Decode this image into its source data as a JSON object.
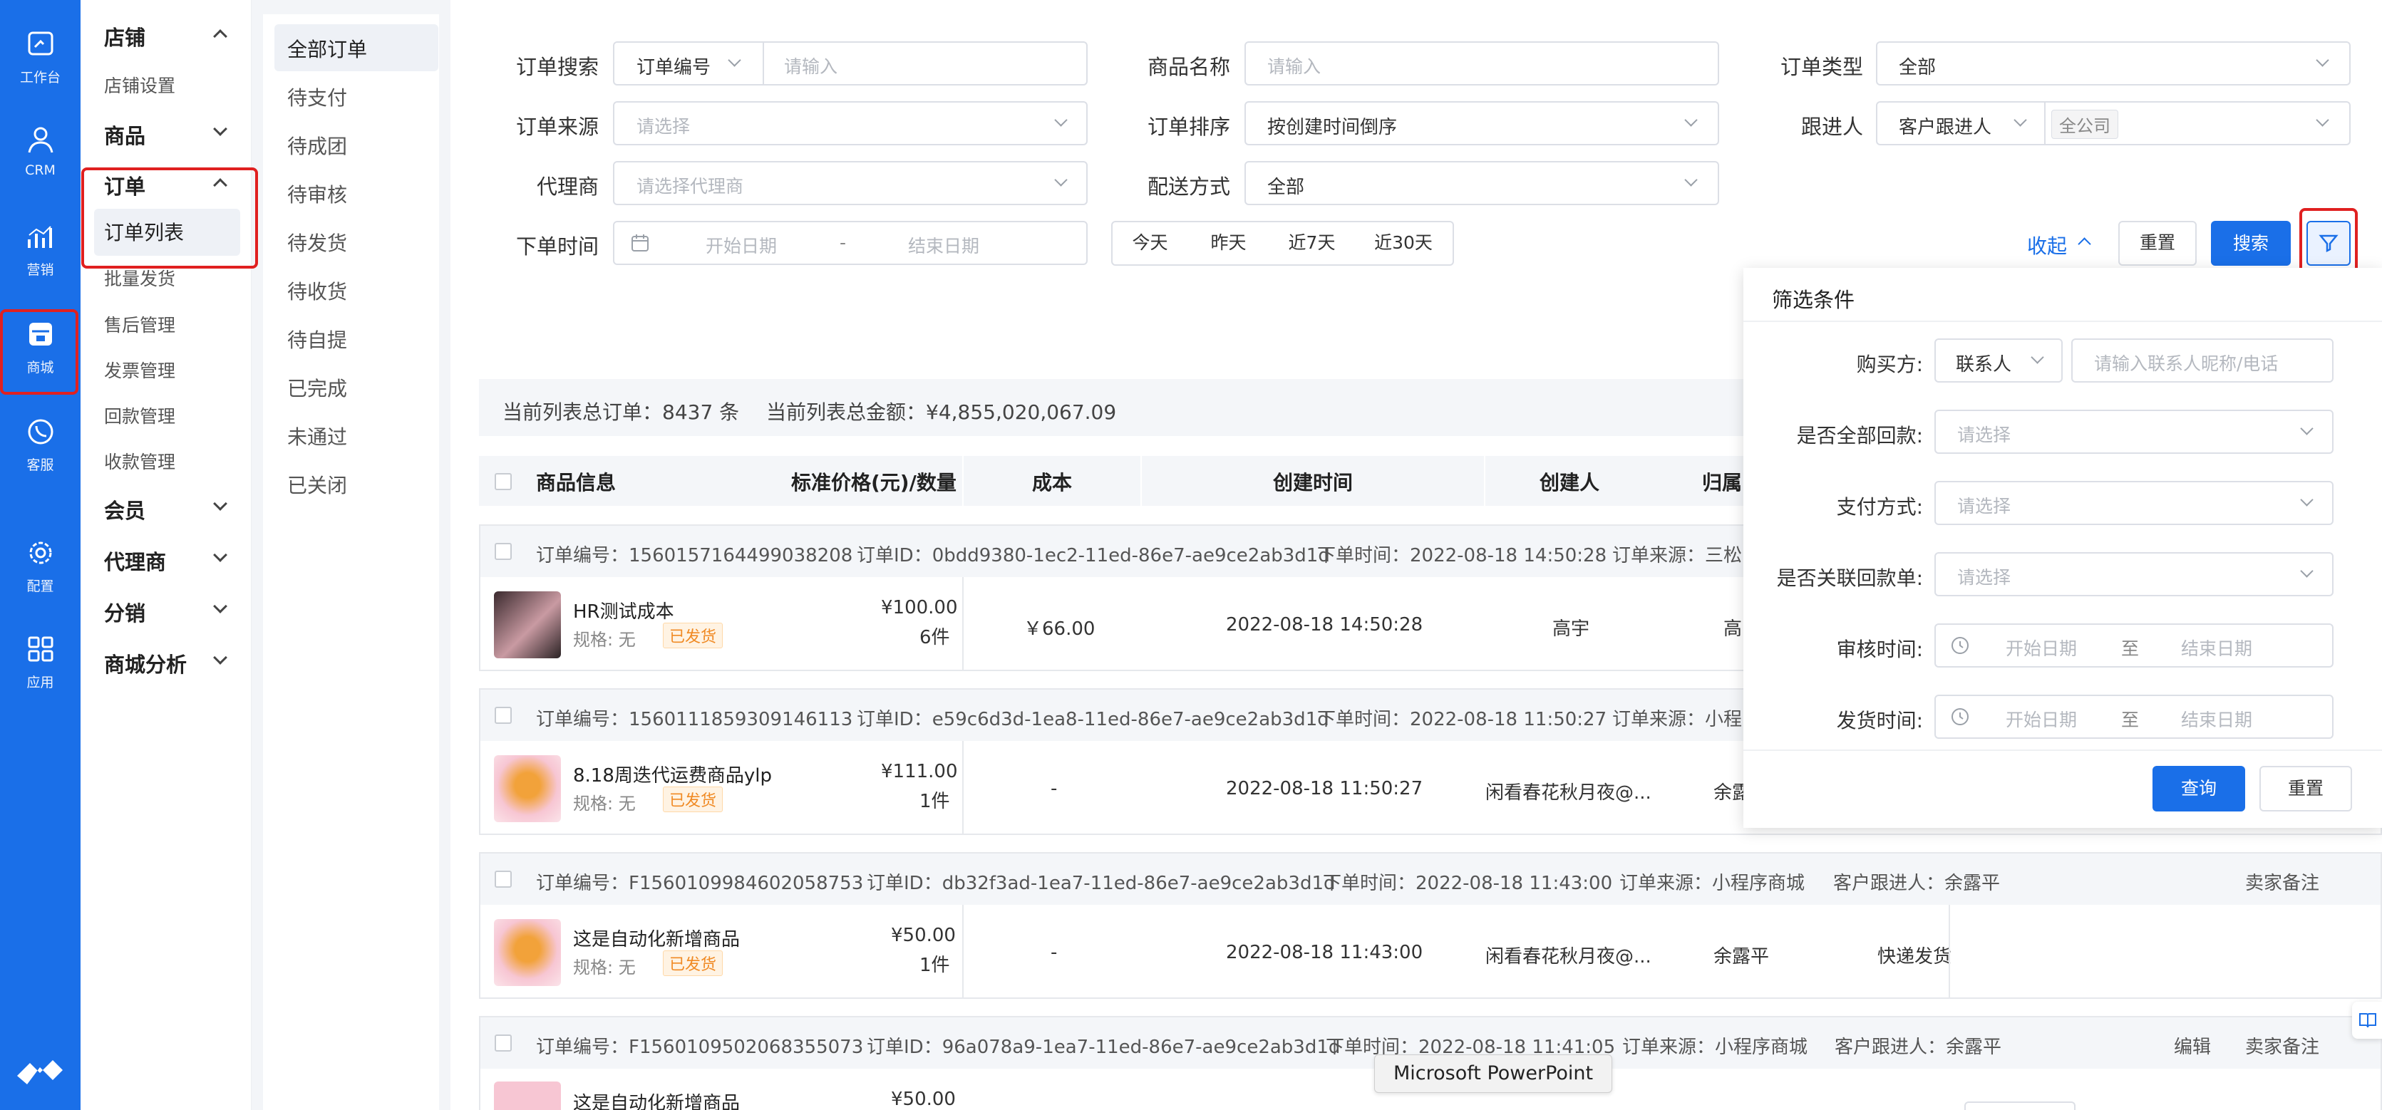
{
  "left_nav": [
    {
      "label": "工作台",
      "icon": "dashboard-icon"
    },
    {
      "label": "CRM",
      "icon": "user-icon"
    },
    {
      "label": "营销",
      "icon": "marketing-chart-icon"
    },
    {
      "label": "商城",
      "icon": "store-icon",
      "active": true
    },
    {
      "label": "客服",
      "icon": "phone-icon"
    },
    {
      "label": "配置",
      "icon": "gear-icon"
    },
    {
      "label": "应用",
      "icon": "apps-grid-icon"
    }
  ],
  "sub_nav": {
    "shop": {
      "label": "店铺",
      "items": [
        "店铺设置"
      ]
    },
    "goods": {
      "label": "商品"
    },
    "order": {
      "label": "订单",
      "items": [
        "订单列表",
        "批量发货",
        "售后管理",
        "发票管理",
        "回款管理",
        "收款管理"
      ]
    },
    "member": {
      "label": "会员"
    },
    "agent": {
      "label": "代理商"
    },
    "distribution": {
      "label": "分销"
    },
    "analytics": {
      "label": "商城分析"
    }
  },
  "status_tabs": [
    "全部订单",
    "待支付",
    "待成团",
    "待审核",
    "待发货",
    "待收货",
    "待自提",
    "已完成",
    "未通过",
    "已关闭"
  ],
  "filters": {
    "order_search": {
      "label": "订单搜索",
      "select": "订单编号",
      "placeholder": "请输入"
    },
    "product_name": {
      "label": "商品名称",
      "placeholder": "请输入"
    },
    "order_type": {
      "label": "订单类型",
      "value": "全部"
    },
    "order_source": {
      "label": "订单来源",
      "placeholder": "请选择"
    },
    "order_sort": {
      "label": "订单排序",
      "value": "按创建时间倒序"
    },
    "follower": {
      "label": "跟进人",
      "select": "客户跟进人",
      "tag": "全公司"
    },
    "agent": {
      "label": "代理商",
      "placeholder": "请选择代理商"
    },
    "delivery": {
      "label": "配送方式",
      "value": "全部"
    },
    "order_time": {
      "label": "下单时间",
      "start": "开始日期",
      "sep": "-",
      "end": "结束日期"
    },
    "quick": [
      "今天",
      "昨天",
      "近7天",
      "近30天"
    ],
    "collapse": "收起",
    "reset": "重置",
    "search": "搜索"
  },
  "summary": {
    "count": "当前列表总订单：8437 条",
    "amount": "当前列表总金额：¥4,855,020,067.09"
  },
  "table_headers": [
    "商品信息",
    "标准价格(元)/数量",
    "成本",
    "创建时间",
    "创建人",
    "归属"
  ],
  "orders": [
    {
      "no": "订单编号：1560157164499038208",
      "id": "订单ID：0bdd9380-1ec2-11ed-86e7-ae9ce2ab3d1d",
      "time": "下单时间：2022-08-18 14:50:28",
      "source": "订单来源：三松",
      "product": "HR测试成本",
      "spec": "规格:   无",
      "status": "已发货",
      "price": "¥100.00",
      "qty": "6件",
      "cost": "￥66.00",
      "created": "2022-08-18 14:50:28",
      "creator": "高宇",
      "owner": "高"
    },
    {
      "no": "订单编号：1560111859309146113",
      "id": "订单ID：e59c6d3d-1ea8-11ed-86e7-ae9ce2ab3d1d",
      "time": "下单时间：2022-08-18 11:50:27",
      "source": "订单来源：小程",
      "product": "8.18周迭代运费商品ylp",
      "spec": "规格:   无",
      "status": "已发货",
      "price": "¥111.00",
      "qty": "1件",
      "cost": "-",
      "created": "2022-08-18 11:50:27",
      "creator": "闲看春花秋月夜@...",
      "owner": "余露"
    },
    {
      "no": "订单编号：F1560109984602058753",
      "id": "订单ID：db32f3ad-1ea7-11ed-86e7-ae9ce2ab3d1d",
      "time": "下单时间：2022-08-18 11:43:00",
      "source": "订单来源：小程序商城",
      "follower": "客户跟进人：余露平",
      "remark": "卖家备注",
      "product": "这是自动化新增商品",
      "spec": "规格:   无",
      "status": "已发货",
      "price": "¥50.00",
      "qty": "1件",
      "cost": "-",
      "created": "2022-08-18 11:43:00",
      "creator": "闲看春花秋月夜@...",
      "owner": "余露平",
      "delivery": "快递发货"
    },
    {
      "no": "订单编号：F1560109502068355073",
      "id": "订单ID：96a078a9-1ea7-11ed-86e7-ae9ce2ab3d1d",
      "time": "下单时间：2022-08-18 11:41:05",
      "source": "订单来源：小程序商城",
      "follower": "客户跟进人：余露平",
      "edit": "编辑",
      "remark": "卖家备注",
      "product": "这是自动化新增商品",
      "price": "¥50.00"
    }
  ],
  "filter_popup": {
    "title": "筛选条件",
    "buyer": {
      "label": "购买方:",
      "select": "联系人",
      "placeholder": "请输入联系人昵称/电话"
    },
    "full_payment": {
      "label": "是否全部回款:",
      "placeholder": "请选择"
    },
    "pay_method": {
      "label": "支付方式:",
      "placeholder": "请选择"
    },
    "linked_payment": {
      "label": "是否关联回款单:",
      "placeholder": "请选择"
    },
    "audit_time": {
      "label": "审核时间:",
      "start": "开始日期",
      "sep": "至",
      "end": "结束日期"
    },
    "ship_time": {
      "label": "发货时间:",
      "start": "开始日期",
      "sep": "至",
      "end": "结束日期"
    },
    "query": "查询",
    "reset": "重置"
  },
  "tooltip": "Microsoft PowerPoint",
  "colors": {
    "primary": "#1a6fe8",
    "highlight": "#e02020",
    "tag_orange": "#f08a24"
  }
}
